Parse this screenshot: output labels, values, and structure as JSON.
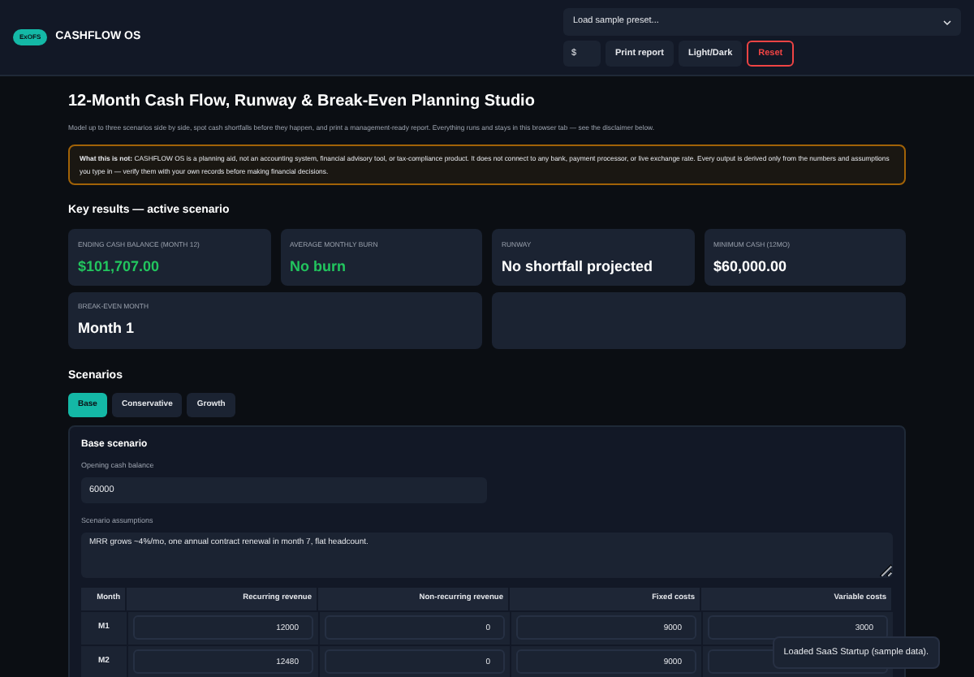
{
  "header": {
    "badge": "ExOFS",
    "brand": "CASHFLOW OS",
    "preset_select": {
      "value": "Load sample preset..."
    },
    "currency_field": {
      "value": "$"
    },
    "buttons": [
      {
        "label": "Print report",
        "kind": "normal"
      },
      {
        "label": "Light/Dark",
        "kind": "normal"
      },
      {
        "label": "Reset",
        "kind": "danger"
      }
    ]
  },
  "title": "12-Month Cash Flow, Runway & Break-Even Planning Studio",
  "intro": "Model up to three scenarios side by side, spot cash shortfalls before they happen, and print a management-ready report. Everything runs and stays in this browser tab — see the disclaimer below.",
  "disclaimer": "**What this is not:** CASHFLOW OS is a planning aid, not an accounting system, financial advisory tool, or tax-compliance product. It does not connect to any bank, payment processor, or live exchange rate. Every output is derived only from the numbers and assumptions you type in — verify them with your own records before making financial decisions.",
  "key_results": {
    "heading": "Key results — active scenario",
    "cards": [
      {
        "label": "ENDING CASH BALANCE (MONTH 12)",
        "value": "$101,707.00",
        "color": "#22c55e"
      },
      {
        "label": "AVERAGE MONTHLY BURN",
        "value": "No burn",
        "color": "#22c55e"
      },
      {
        "label": "RUNWAY",
        "value": "No shortfall projected",
        "color": "#ffffff"
      },
      {
        "label": "MINIMUM CASH (12MO)",
        "value": "$60,000.00",
        "color": "#ffffff"
      },
      {
        "label": "BREAK-EVEN MONTH",
        "value": "Month 1",
        "color": "#ffffff"
      }
    ]
  },
  "scenarios": {
    "heading": "Scenarios",
    "tabs": [
      {
        "label": "Base",
        "selected": true
      },
      {
        "label": "Conservative",
        "selected": false
      },
      {
        "label": "Growth",
        "selected": false
      }
    ],
    "panel": {
      "title": "Base scenario",
      "opening_cash": {
        "label": "Opening cash balance",
        "value": "60000"
      },
      "assumptions": {
        "label": "Scenario assumptions",
        "value": "MRR grows ~4%/mo, one annual contract renewal in month 7, flat headcount."
      },
      "table": {
        "columns": [
          "Month",
          "Recurring revenue",
          "Non-recurring revenue",
          "Fixed costs",
          "Variable costs"
        ],
        "rows": [
          {
            "cells": [
              "M1",
              "12000",
              "0",
              "9000",
              "3000"
            ]
          },
          {
            "cells": [
              "M2",
              "12480",
              "0",
              "9000"
            ]
          }
        ]
      }
    }
  },
  "toast": "Loaded SaaS Startup (sample data)."
}
